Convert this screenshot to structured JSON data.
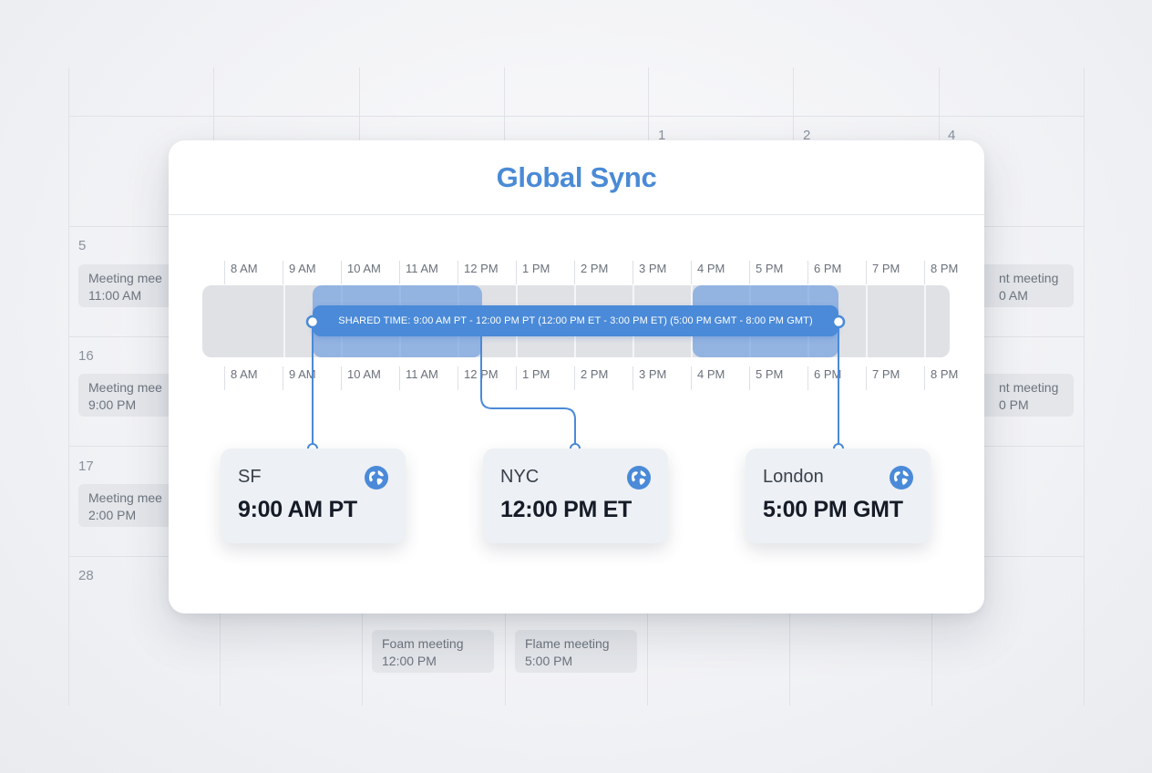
{
  "calendar": {
    "day_numbers": [
      {
        "label": "1"
      },
      {
        "label": "2"
      },
      {
        "label": "4"
      },
      {
        "label": "5"
      },
      {
        "label": "16"
      },
      {
        "label": "17"
      },
      {
        "label": "28"
      }
    ],
    "events": [
      {
        "title": "Meeting mee",
        "time": "11:00 AM"
      },
      {
        "title": "Meeting mee",
        "time": "9:00 PM"
      },
      {
        "title": "Meeting mee",
        "time": "2:00 PM"
      },
      {
        "title": "nt meeting",
        "time": "0 AM"
      },
      {
        "title": "nt meeting",
        "time": "0 PM"
      },
      {
        "title": "Foam meeting",
        "time": "12:00 PM"
      },
      {
        "title": "Flame meeting",
        "time": "5:00 PM"
      }
    ]
  },
  "modal": {
    "title": "Global Sync",
    "hours_top": [
      "8 AM",
      "9 AM",
      "10 AM",
      "11 AM",
      "12 PM",
      "1 PM",
      "2 PM",
      "3 PM",
      "4 PM",
      "5 PM",
      "6 PM",
      "7 PM",
      "8 PM"
    ],
    "hours_bottom": [
      "8 AM",
      "9 AM",
      "10 AM",
      "11 AM",
      "12 PM",
      "1 PM",
      "2 PM",
      "3 PM",
      "4 PM",
      "5 PM",
      "6 PM",
      "7 PM",
      "8 PM"
    ],
    "shared_time_label": "SHARED TIME: 9:00 AM PT - 12:00 PM PT (12:00 PM ET - 3:00 PM ET) (5:00 PM GMT - 8:00 PM GMT)",
    "cities": [
      {
        "name": "SF",
        "time": "9:00 AM PT",
        "icon": "globe-icon"
      },
      {
        "name": "NYC",
        "time": "12:00 PM ET",
        "icon": "globe-icon"
      },
      {
        "name": "London",
        "time": "5:00 PM GMT",
        "icon": "globe-icon"
      }
    ]
  },
  "colors": {
    "accent": "#4a8ad6",
    "highlight_zone": "#6f9ede",
    "track": "#dfe1e5",
    "card": "#edf0f4"
  }
}
